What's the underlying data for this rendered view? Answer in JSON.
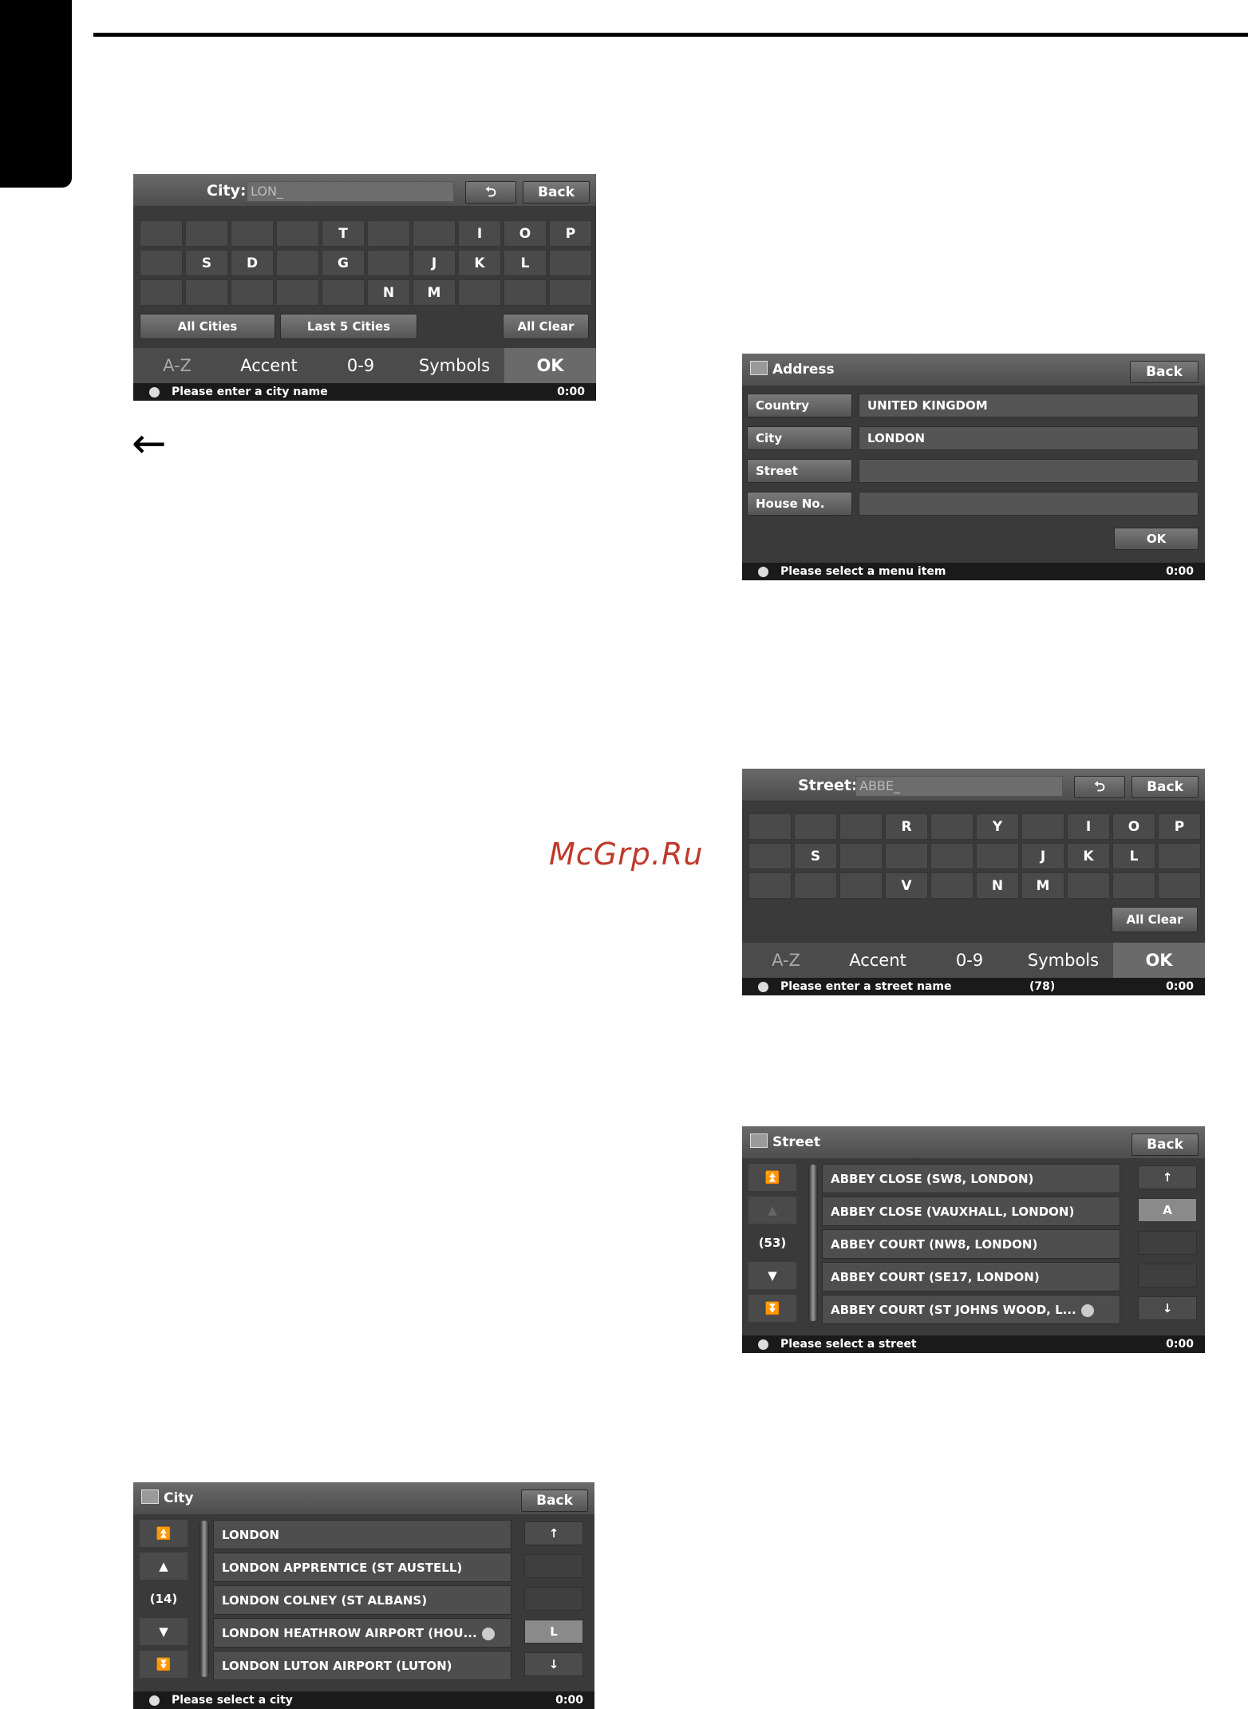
{
  "city_keyboard": {
    "label": "City:",
    "input_value": "LON_",
    "back": "Back",
    "keys_row1": [
      "",
      "",
      "",
      "",
      "T",
      "",
      "",
      "I",
      "O",
      "P"
    ],
    "keys_row2": [
      "",
      "S",
      "D",
      "",
      "G",
      "",
      "J",
      "K",
      "L",
      ""
    ],
    "keys_row3": [
      "",
      "",
      "",
      "",
      "",
      "N",
      "M",
      "",
      "",
      ""
    ],
    "all_cities": "All Cities",
    "last5": "Last 5 Cities",
    "all_clear": "All Clear",
    "modes": [
      "A-Z",
      "Accent",
      "0-9",
      "Symbols",
      "OK"
    ],
    "status": "Please enter a city name",
    "time": "0:00"
  },
  "arrow_symbol": "←",
  "address": {
    "title": "Address",
    "back": "Back",
    "rows": [
      {
        "label": "Country",
        "value": "UNITED KINGDOM"
      },
      {
        "label": "City",
        "value": "LONDON"
      },
      {
        "label": "Street",
        "value": ""
      },
      {
        "label": "House No.",
        "value": ""
      }
    ],
    "ok": "OK",
    "status": "Please select a menu item",
    "time": "0:00"
  },
  "watermark": "McGrp.Ru",
  "street_keyboard": {
    "label": "Street:",
    "input_value": "ABBE_",
    "back": "Back",
    "keys_row1": [
      "",
      "",
      "",
      "R",
      "",
      "Y",
      "",
      "I",
      "O",
      "P"
    ],
    "keys_row2": [
      "",
      "S",
      "",
      "",
      "",
      "",
      "J",
      "K",
      "L",
      ""
    ],
    "keys_row3": [
      "",
      "",
      "",
      "V",
      "",
      "N",
      "M",
      "",
      "",
      ""
    ],
    "all_clear": "All Clear",
    "modes": [
      "A-Z",
      "Accent",
      "0-9",
      "Symbols",
      "OK"
    ],
    "status": "Please enter a street name",
    "count": "(78)",
    "time": "0:00"
  },
  "street_list": {
    "title": "Street",
    "back": "Back",
    "count": "(53)",
    "items": [
      "ABBEY CLOSE (SW8, LONDON)",
      "ABBEY CLOSE (VAUXHALL, LONDON)",
      "ABBEY COURT (NW8, LONDON)",
      "ABBEY COURT (SE17, LONDON)",
      "ABBEY COURT (ST JOHNS WOOD, L..."
    ],
    "right_letter": "A",
    "status": "Please select a street",
    "time": "0:00"
  },
  "city_list": {
    "title": "City",
    "back": "Back",
    "count": "(14)",
    "items": [
      "LONDON",
      "LONDON APPRENTICE (ST AUSTELL)",
      "LONDON COLNEY (ST ALBANS)",
      "LONDON HEATHROW AIRPORT (HOU...",
      "LONDON LUTON AIRPORT (LUTON)"
    ],
    "right_letter": "L",
    "status": "Please select a city",
    "time": "0:00"
  }
}
